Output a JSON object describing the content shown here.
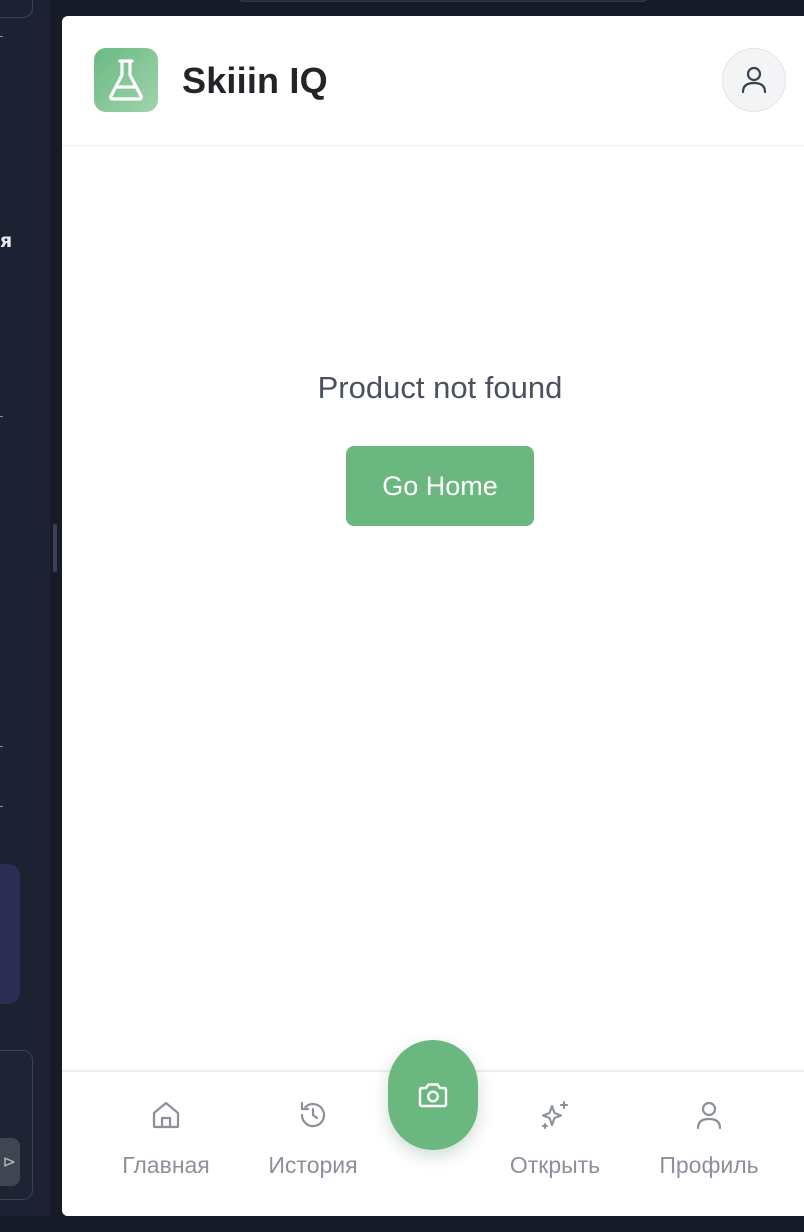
{
  "header": {
    "app_title": "Skiiin IQ",
    "logo_icon": "flask-icon",
    "profile_icon": "user-icon"
  },
  "main": {
    "message": "Product not found",
    "go_home_label": "Go Home"
  },
  "bottom_nav": {
    "items": [
      {
        "label": "Главная",
        "icon": "home-icon"
      },
      {
        "label": "История",
        "icon": "history-icon"
      },
      {
        "label": "Открыть",
        "icon": "sparkles-icon"
      },
      {
        "label": "Профиль",
        "icon": "user-icon"
      }
    ],
    "scan_button_icon": "camera-icon"
  },
  "sidebar_fragment": {
    "glyph": "я",
    "send_glyph": "⊳"
  },
  "colors": {
    "accent": "#6ab87f",
    "logo_gradient_start": "#6ab983",
    "logo_gradient_end": "#9fd4ac",
    "text_primary": "#222428",
    "text_muted": "#8b909a",
    "background_dark": "#161b27"
  }
}
